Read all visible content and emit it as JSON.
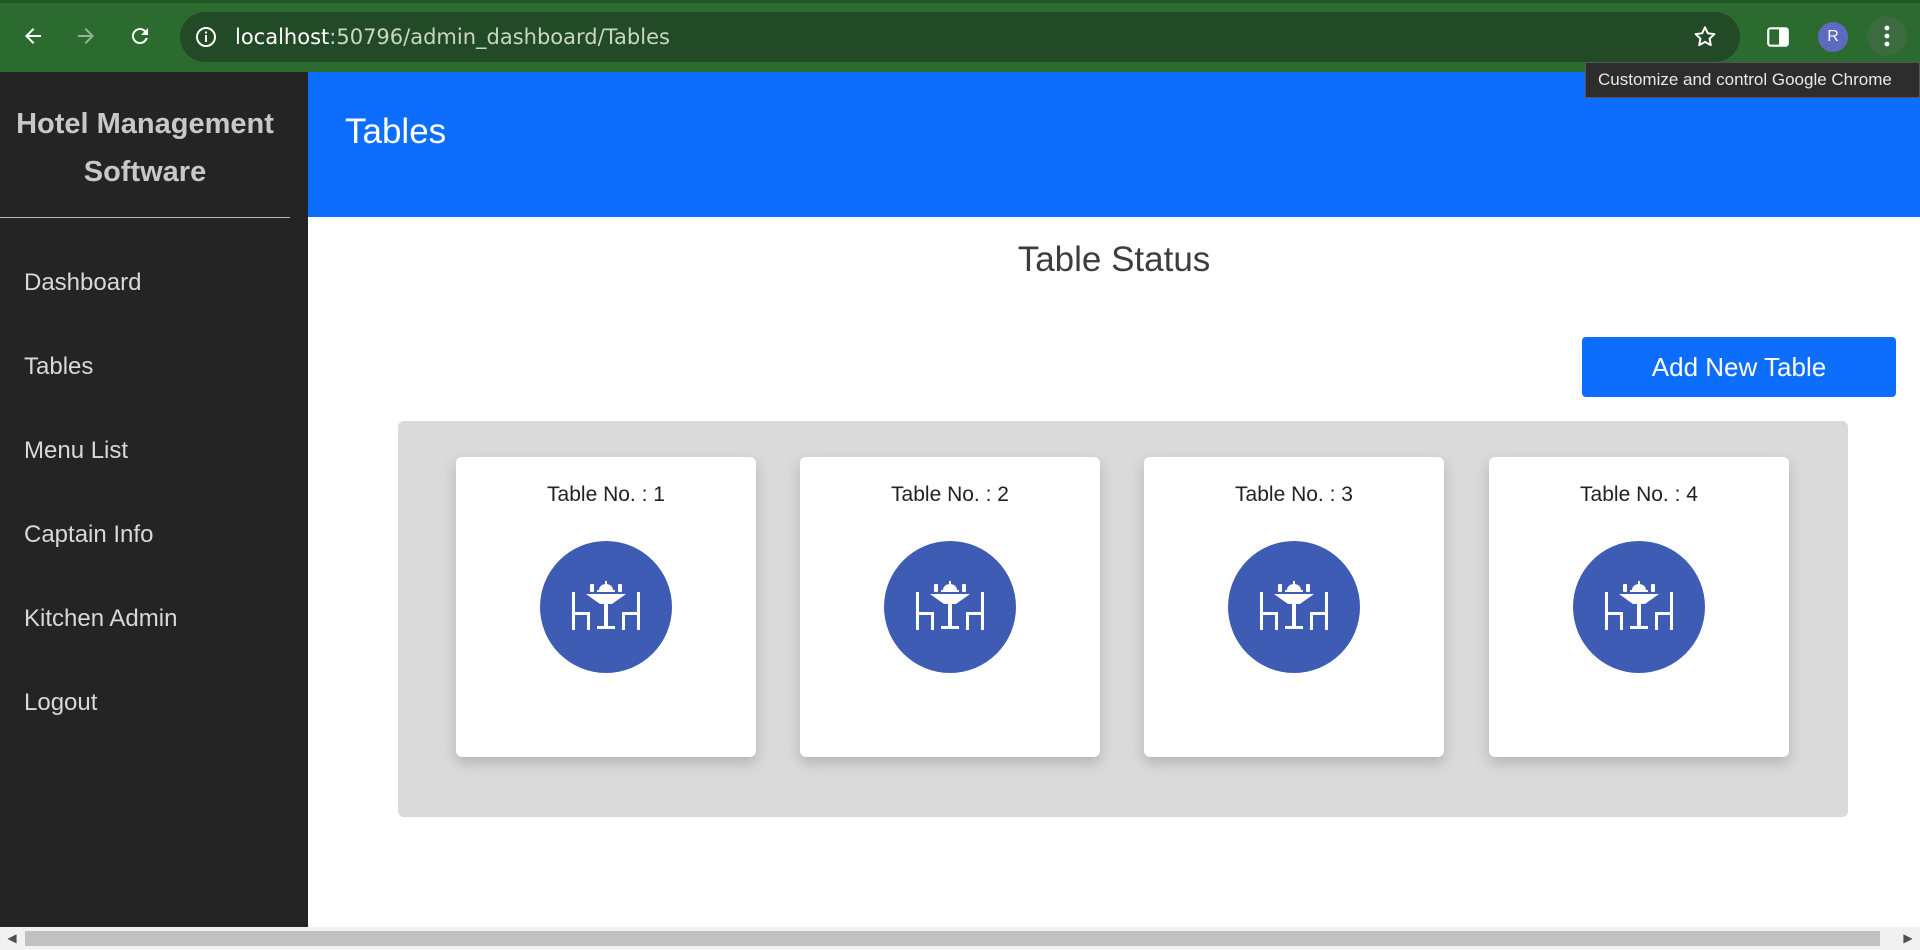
{
  "browser": {
    "url_host": "localhost",
    "url_rest": ":50796/admin_dashboard/Tables",
    "profile_initial": "R",
    "tooltip": "Customize and control Google Chrome"
  },
  "sidebar": {
    "brand_line1": "Hotel Management",
    "brand_line2": "Software",
    "items": [
      {
        "label": "Dashboard"
      },
      {
        "label": "Tables"
      },
      {
        "label": "Menu List"
      },
      {
        "label": "Captain Info"
      },
      {
        "label": "Kitchen Admin"
      },
      {
        "label": "Logout"
      }
    ]
  },
  "header": {
    "title": "Tables"
  },
  "main": {
    "section_title": "Table Status",
    "add_button": "Add New Table",
    "tables": [
      {
        "label": "Table No. : 1"
      },
      {
        "label": "Table No. : 2"
      },
      {
        "label": "Table No. : 3"
      },
      {
        "label": "Table No. : 4"
      }
    ]
  },
  "colors": {
    "header_bg": "#0d6efd",
    "sidebar_bg": "#242424",
    "table_icon_bg": "#3f5cb5",
    "browser_frame": "#2b6b30"
  },
  "icons": {
    "table": "dining-table-icon"
  }
}
